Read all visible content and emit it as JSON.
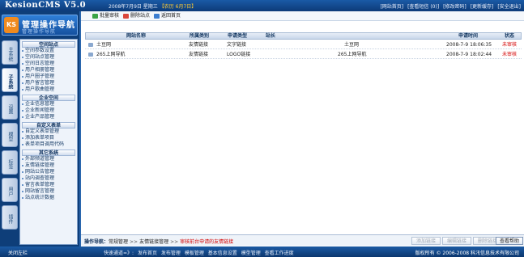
{
  "header": {
    "title": "KesionCMS V5.0",
    "date": "2008年7月9日 星期三",
    "lunar": "【农历 6月7日】",
    "links": [
      "[网站首页]",
      "[查看短信 (0)]",
      "[修改密码]",
      "[更新缓存]",
      "[安全退出]"
    ]
  },
  "logo": {
    "badge": "KS",
    "title": "管理操作导航",
    "subtitle": "管理操作导航"
  },
  "vtabs": [
    "主系统",
    "子系统",
    "设置",
    "模型",
    "标签",
    "用户",
    "插件"
  ],
  "menu": [
    {
      "section": "空间站点",
      "items": [
        "空间参数设置",
        "空间站点管理",
        "空间日志管理",
        "用户相册管理",
        "用户圈子管理",
        "用户留言管理",
        "用户歌曲管理"
      ]
    },
    {
      "section": "企业空间",
      "items": [
        "企业信息管理",
        "企业新闻管理",
        "企业产品管理"
      ]
    },
    {
      "section": "自定义表单",
      "items": [
        "自定义表单管理",
        "添加表单项目",
        "表单项目调用代码"
      ]
    },
    {
      "section": "其它系统",
      "items": [
        "外部频道管理",
        "友情链接管理",
        "网站公告管理",
        "站内调查管理",
        "留言表单管理",
        "网站留言管理",
        "站点统计数据"
      ]
    }
  ],
  "toolbar": {
    "batch": "批量审核",
    "delete": "删除站点",
    "back": "返回首页"
  },
  "table": {
    "headers": [
      "网站名称",
      "所属类别",
      "申请类型",
      "站长",
      "申请时间",
      "状态"
    ],
    "rows": [
      [
        "土豆网",
        "友情链接",
        "文字链接",
        "土豆网",
        "2008-7-9 18:06:35",
        "未审核"
      ],
      [
        "265上网导航",
        "友情链接",
        "LOGO链接",
        "265上网导航",
        "2008-7-9 18:02:44",
        "未审核"
      ]
    ]
  },
  "guide": {
    "label": "操作导航：",
    "crumbs": [
      "常规管理",
      "友情链接管理",
      "审核前台申请的友情链接"
    ]
  },
  "actions": [
    "添加链接",
    "编辑链接",
    "删除链接",
    "查看帮助"
  ],
  "footer": {
    "close": "关闭左栏",
    "links": [
      "快速通道=》:",
      "发布首页",
      "发布管理",
      "模板管理",
      "基本信息设置",
      "模型管理",
      "查看工作进度"
    ],
    "copyright": "版权所有 © 2006-2008 科汛信息技术有限公司"
  }
}
